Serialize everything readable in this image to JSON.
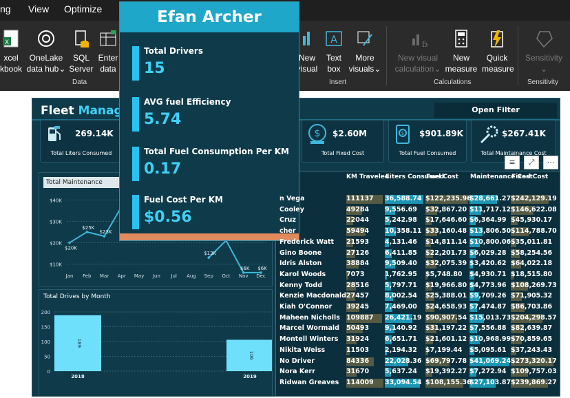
{
  "menu": {
    "items": [
      "ng",
      "View",
      "Optimize"
    ]
  },
  "ribbon": {
    "buttons": [
      {
        "label1": "xcel",
        "label2": "kbook",
        "chev": ""
      },
      {
        "label1": "OneLake",
        "label2": "data hub",
        "chev": "⌄"
      },
      {
        "label1": "SQL",
        "label2": "Server",
        "chev": ""
      },
      {
        "label1": "Enter",
        "label2": "data",
        "chev": ""
      },
      {
        "label1": "New",
        "label2": "visual",
        "chev": ""
      },
      {
        "label1": "Text",
        "label2": "box",
        "chev": ""
      },
      {
        "label1": "More",
        "label2": "visuals",
        "chev": "⌄"
      },
      {
        "label1": "New visual",
        "label2": "calculation",
        "chev": "⌄"
      },
      {
        "label1": "New",
        "label2": "measure",
        "chev": ""
      },
      {
        "label1": "Quick",
        "label2": "measure",
        "chev": ""
      },
      {
        "label1": "Sensitivity",
        "label2": "",
        "chev": "⌄"
      }
    ],
    "groups": {
      "data": "Data",
      "insert": "Insert",
      "calculations": "Calculations",
      "sensitivity": "Sensitivity"
    }
  },
  "report": {
    "title_main": "Fleet ",
    "title_accent": "Manag",
    "fragment": "s",
    "open_filter": "Open Filter",
    "kpis": [
      {
        "value": "269.14K",
        "label": "Total Liters Consumed",
        "icon": "fuel-pump-icon"
      },
      {
        "value": "$2.60M",
        "label": "Total Fixed Cost",
        "icon": "money-icon"
      },
      {
        "value": "$901.89K",
        "label": "Total Fuel Consumed",
        "icon": "fuel-gauge-icon"
      },
      {
        "value": "$267.41K",
        "label": "Total Maintainance Cost",
        "icon": "wrench-gear-icon"
      }
    ]
  },
  "line_chart": {
    "selector": "Total Maintenance",
    "y_ticks": [
      "$40K",
      "$30K",
      "$20K",
      "$10K"
    ],
    "visible_points": [
      {
        "month": "Jan",
        "label": "$20K"
      },
      {
        "month": "Feb",
        "label": "$25K"
      },
      {
        "month": "Mar",
        "label": "$23K"
      },
      {
        "month": "Sep",
        "label": "$13K"
      },
      {
        "month": "Nov",
        "label": "$6K"
      },
      {
        "month": "Dec",
        "label": "$6K"
      }
    ]
  },
  "bar_chart": {
    "title": "Total Drives by Month",
    "y_ticks": [
      "200",
      "150",
      "100",
      "50",
      "0"
    ]
  },
  "table": {
    "headers": [
      "KM Traveled",
      "Liters Consumed",
      "Fuel Cost",
      "Maintenance Cost",
      "Fixed Cost"
    ],
    "rows": [
      {
        "name": "n Vega",
        "km": "111137",
        "liters": "36,588.74",
        "fuel": "$122,235.96",
        "maint": "$28,661.27",
        "fixed": "$242,129.19"
      },
      {
        "name": "Cooley",
        "km": "49284",
        "liters": "9,556.69",
        "fuel": "$32,867.20",
        "maint": "$11,717.12",
        "fixed": "$146,622.08"
      },
      {
        "name": "Cruz",
        "km": "22044",
        "liters": "5,242.98",
        "fuel": "$17,646.60",
        "maint": "$6,364.99",
        "fixed": "$45,930.17"
      },
      {
        "name": "cher",
        "km": "59494",
        "liters": "10,358.11",
        "fuel": "$33,160.48",
        "maint": "$13,806.50",
        "fixed": "$114,788.70"
      },
      {
        "name": "Frederick Watt",
        "km": "21593",
        "liters": "4,131.46",
        "fuel": "$14,811.14",
        "maint": "$10,800.06",
        "fixed": "$35,011.81"
      },
      {
        "name": "Gino Boone",
        "km": "27126",
        "liters": "6,411.85",
        "fuel": "$22,201.73",
        "maint": "$6,029.28",
        "fixed": "$58,254.56"
      },
      {
        "name": "Idris Alston",
        "km": "38884",
        "liters": "9,509.40",
        "fuel": "$32,075.39",
        "maint": "$3,420.62",
        "fixed": "$64,022.18"
      },
      {
        "name": "Karol Woods",
        "km": "7073",
        "liters": "1,762.95",
        "fuel": "$5,748.80",
        "maint": "$4,930.71",
        "fixed": "$18,515.80"
      },
      {
        "name": "Kenny Todd",
        "km": "28516",
        "liters": "5,797.71",
        "fuel": "$19,966.80",
        "maint": "$4,773.96",
        "fixed": "$108,269.73"
      },
      {
        "name": "Kenzie Macdonald",
        "km": "27457",
        "liters": "8,002.54",
        "fuel": "$25,388.01",
        "maint": "$9,709.26",
        "fixed": "$71,905.32"
      },
      {
        "name": "Kiah O'Connor",
        "km": "39245",
        "liters": "7,469.00",
        "fuel": "$24,658.93",
        "maint": "$7,474.87",
        "fixed": "$86,703.86"
      },
      {
        "name": "Maheen Nicholls",
        "km": "109887",
        "liters": "26,421.19",
        "fuel": "$90,907.54",
        "maint": "$15,013.73",
        "fixed": "$204,298.57"
      },
      {
        "name": "Marcel Wormald",
        "km": "50493",
        "liters": "9,140.92",
        "fuel": "$31,197.22",
        "maint": "$7,556.88",
        "fixed": "$82,639.87"
      },
      {
        "name": "Montell Winters",
        "km": "31924",
        "liters": "6,651.71",
        "fuel": "$21,601.12",
        "maint": "$10,968.99",
        "fixed": "$70,859.65"
      },
      {
        "name": "Nikita Weiss",
        "km": "11503",
        "liters": "2,194.32",
        "fuel": "$7,199.44",
        "maint": "$5,095.61",
        "fixed": "$37,243.43"
      },
      {
        "name": "No Driver",
        "km": "84336",
        "liters": "22,028.36",
        "fuel": "$69,797.78",
        "maint": "$41,069.24",
        "fixed": "$273,320.17"
      },
      {
        "name": "Nora Kerr",
        "km": "31670",
        "liters": "5,637.24",
        "fuel": "$19,392.27",
        "maint": "$7,272.94",
        "fixed": "$109,757.03"
      },
      {
        "name": "Ridwan Greaves",
        "km": "114009",
        "liters": "33,094.54",
        "fuel": "$108,155.36",
        "maint": "$27,103.87",
        "fixed": "$239,869.27"
      }
    ]
  },
  "tooltip": {
    "name": "Efan Archer",
    "items": [
      {
        "label": "Total Drivers",
        "value": "15"
      },
      {
        "label": "AVG fuel Efficiency",
        "value": "5.74"
      },
      {
        "label": "Total Fuel Consumption Per KM",
        "value": "0.17"
      },
      {
        "label": "Fuel Cost Per KM",
        "value": "$0.56"
      }
    ]
  },
  "chart_data": [
    {
      "type": "line",
      "title": "",
      "selector": "Total Maintenance",
      "categories": [
        "Jan",
        "Feb",
        "Mar",
        "Apr",
        "May",
        "Jun",
        "Jul",
        "Aug",
        "Sep",
        "Oct",
        "Nov",
        "Dec"
      ],
      "values": [
        20,
        25,
        23,
        37,
        null,
        null,
        null,
        null,
        13,
        21,
        6,
        6
      ],
      "value_labels": [
        "$20K",
        "$25K",
        "$23K",
        "",
        "",
        "",
        "",
        "",
        "$13K",
        "",
        "$6K",
        "$6K"
      ],
      "y_ticks": [
        "$10K",
        "$20K",
        "$30K",
        "$40K"
      ],
      "ylim": [
        5,
        43
      ],
      "grid": true,
      "color": "#3fb8dc"
    },
    {
      "type": "bar",
      "title": "Total Drives by Month",
      "categories": [
        "2018",
        "2019"
      ],
      "values": [
        189,
        106
      ],
      "ylim": [
        0,
        200
      ],
      "y_ticks": [
        "0",
        "50",
        "100",
        "150",
        "200"
      ],
      "color": "#6fe0fb"
    }
  ],
  "colors": {
    "accent": "#3fd0f5",
    "panel": "#0f3a4a",
    "tooltip_header": "#1ea7c8",
    "tooltip_footer": "#e08a5e",
    "highlight": "#1ea7c8",
    "olive": "#6e6a45"
  }
}
